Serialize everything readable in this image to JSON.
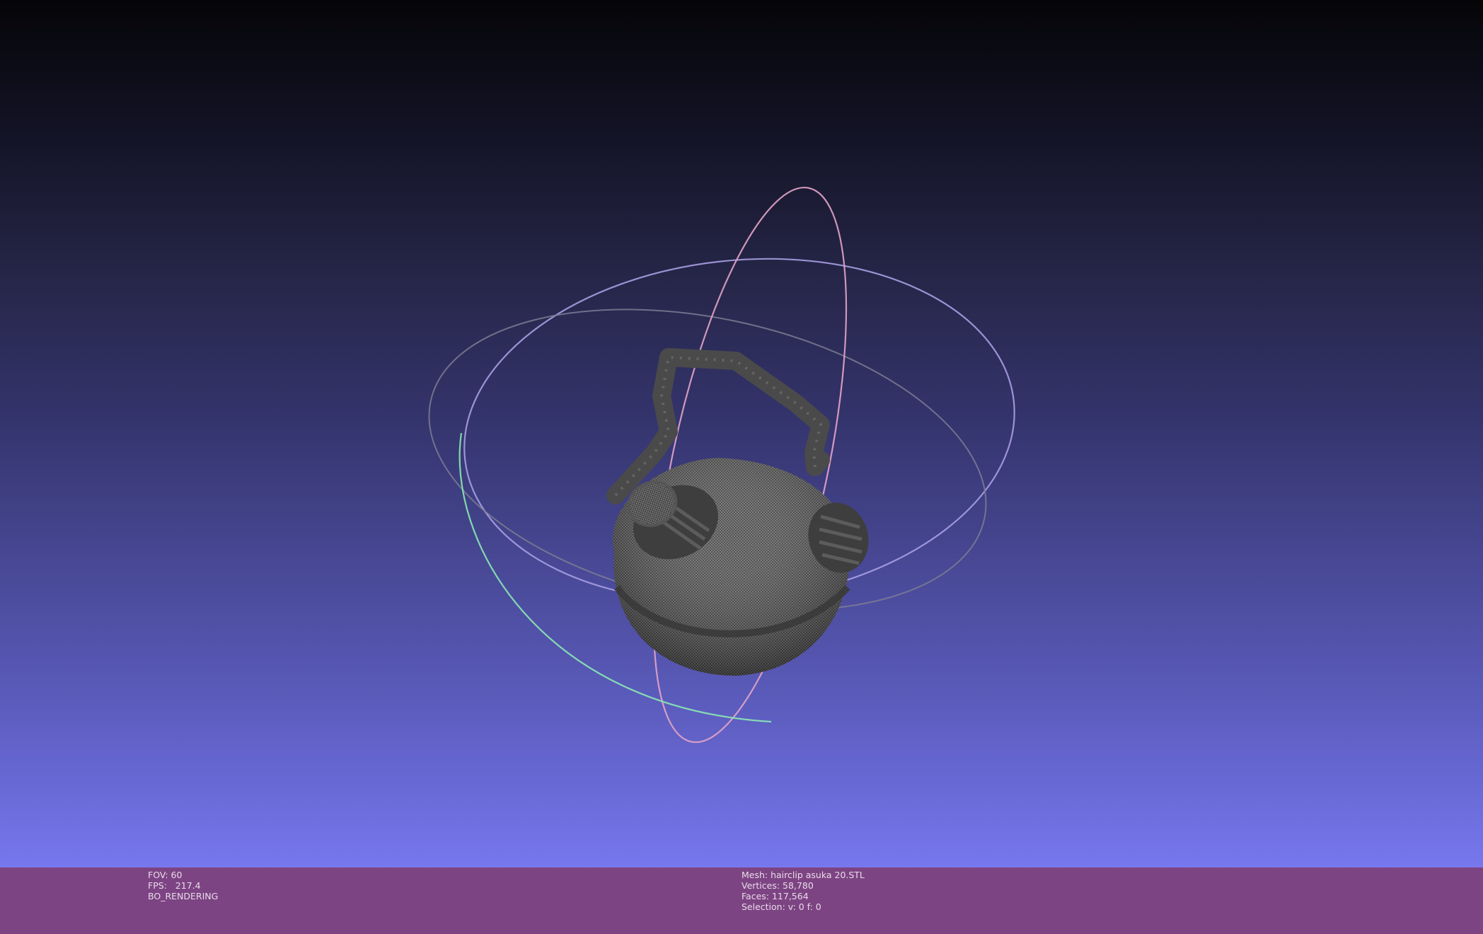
{
  "colors": {
    "info_bar_bg": "#7d4483",
    "mesh_color": "#4a4a4a",
    "trackball_x": "#a898e8",
    "trackball_y": "#e3a4c7",
    "trackball_z": "#8be8b4"
  },
  "render_info": {
    "fov": "FOV: 60",
    "fps": "FPS:   217.4",
    "mode": "BO_RENDERING"
  },
  "mesh_info": {
    "mesh": "Mesh: hairclip asuka 20.STL",
    "vertices": "Vertices: 58,780",
    "faces": "Faces: 117,564",
    "selection": "Selection: v: 0 f: 0"
  },
  "icons": {
    "trackball": "trackball-gizmo-icon",
    "mesh": "wireframe-mesh-icon"
  }
}
